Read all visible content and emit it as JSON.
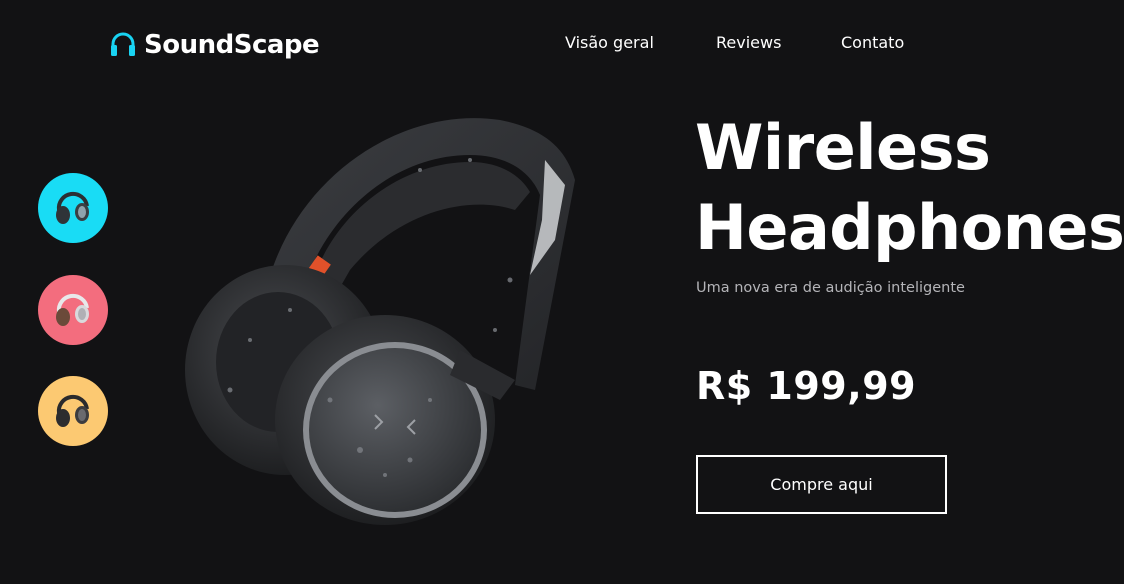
{
  "brand": {
    "name": "SoundScape",
    "icon": "headphones-icon",
    "accent_color": "#19d3f2"
  },
  "nav": {
    "items": [
      {
        "label": "Visão geral"
      },
      {
        "label": "Reviews"
      },
      {
        "label": "Contato"
      }
    ]
  },
  "thumbnails": [
    {
      "icon": "headphones-thumb-icon",
      "bg_color": "#19dcf5"
    },
    {
      "icon": "headphones-thumb-icon",
      "bg_color": "#f36d7e"
    },
    {
      "icon": "headphones-thumb-icon",
      "bg_color": "#fcc972"
    }
  ],
  "hero": {
    "title_line1": "Wireless",
    "title_line2": "Headphones",
    "subtitle": "Uma nova era de audição inteligente",
    "price": "R$ 199,99",
    "cta_label": "Compre aqui",
    "image_icon": "headphones-product-image"
  },
  "colors": {
    "background": "#121214",
    "text": "#ffffff",
    "muted_text": "#b4b4b8"
  }
}
